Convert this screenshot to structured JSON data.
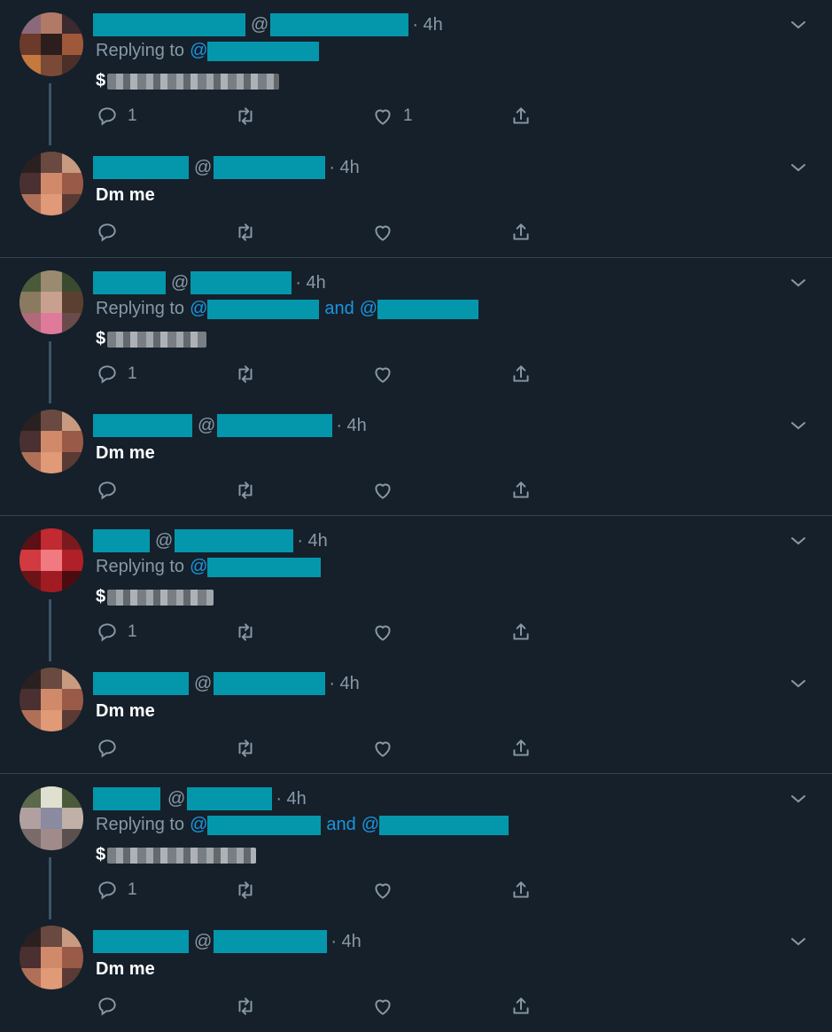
{
  "threads": [
    {
      "first": {
        "time": "4h",
        "replying_prefix": "Replying to",
        "replying_and": "",
        "at": "@",
        "text_prefix": "$",
        "reply_count": "1",
        "like_count": "1"
      },
      "second": {
        "at": "@",
        "time": "4h",
        "text": "Dm me"
      }
    },
    {
      "first": {
        "time": "4h",
        "replying_prefix": "Replying to",
        "replying_and": "and",
        "at": "@",
        "text_prefix": "$",
        "reply_count": "1",
        "like_count": ""
      },
      "second": {
        "at": "@",
        "time": "4h",
        "text": "Dm me"
      }
    },
    {
      "first": {
        "time": "4h",
        "replying_prefix": "Replying to",
        "replying_and": "",
        "at": "@",
        "text_prefix": "$",
        "reply_count": "1",
        "like_count": ""
      },
      "second": {
        "at": "@",
        "time": "4h",
        "text": "Dm me"
      }
    },
    {
      "first": {
        "time": "4h",
        "replying_prefix": "Replying to",
        "replying_and": "and",
        "at": "@",
        "text_prefix": "$",
        "reply_count": "1",
        "like_count": ""
      },
      "second": {
        "at": "@",
        "time": "4h",
        "text": "Dm me"
      }
    }
  ],
  "icons": {
    "reply": "reply-icon",
    "retweet": "retweet-icon",
    "like": "heart-icon",
    "share": "share-icon",
    "more": "chevron-down-icon"
  },
  "colors": {
    "background": "#15202b",
    "redaction": "#0497ac",
    "link": "#1b95e0",
    "secondary_text": "#8899a6",
    "divider": "#38444d"
  }
}
